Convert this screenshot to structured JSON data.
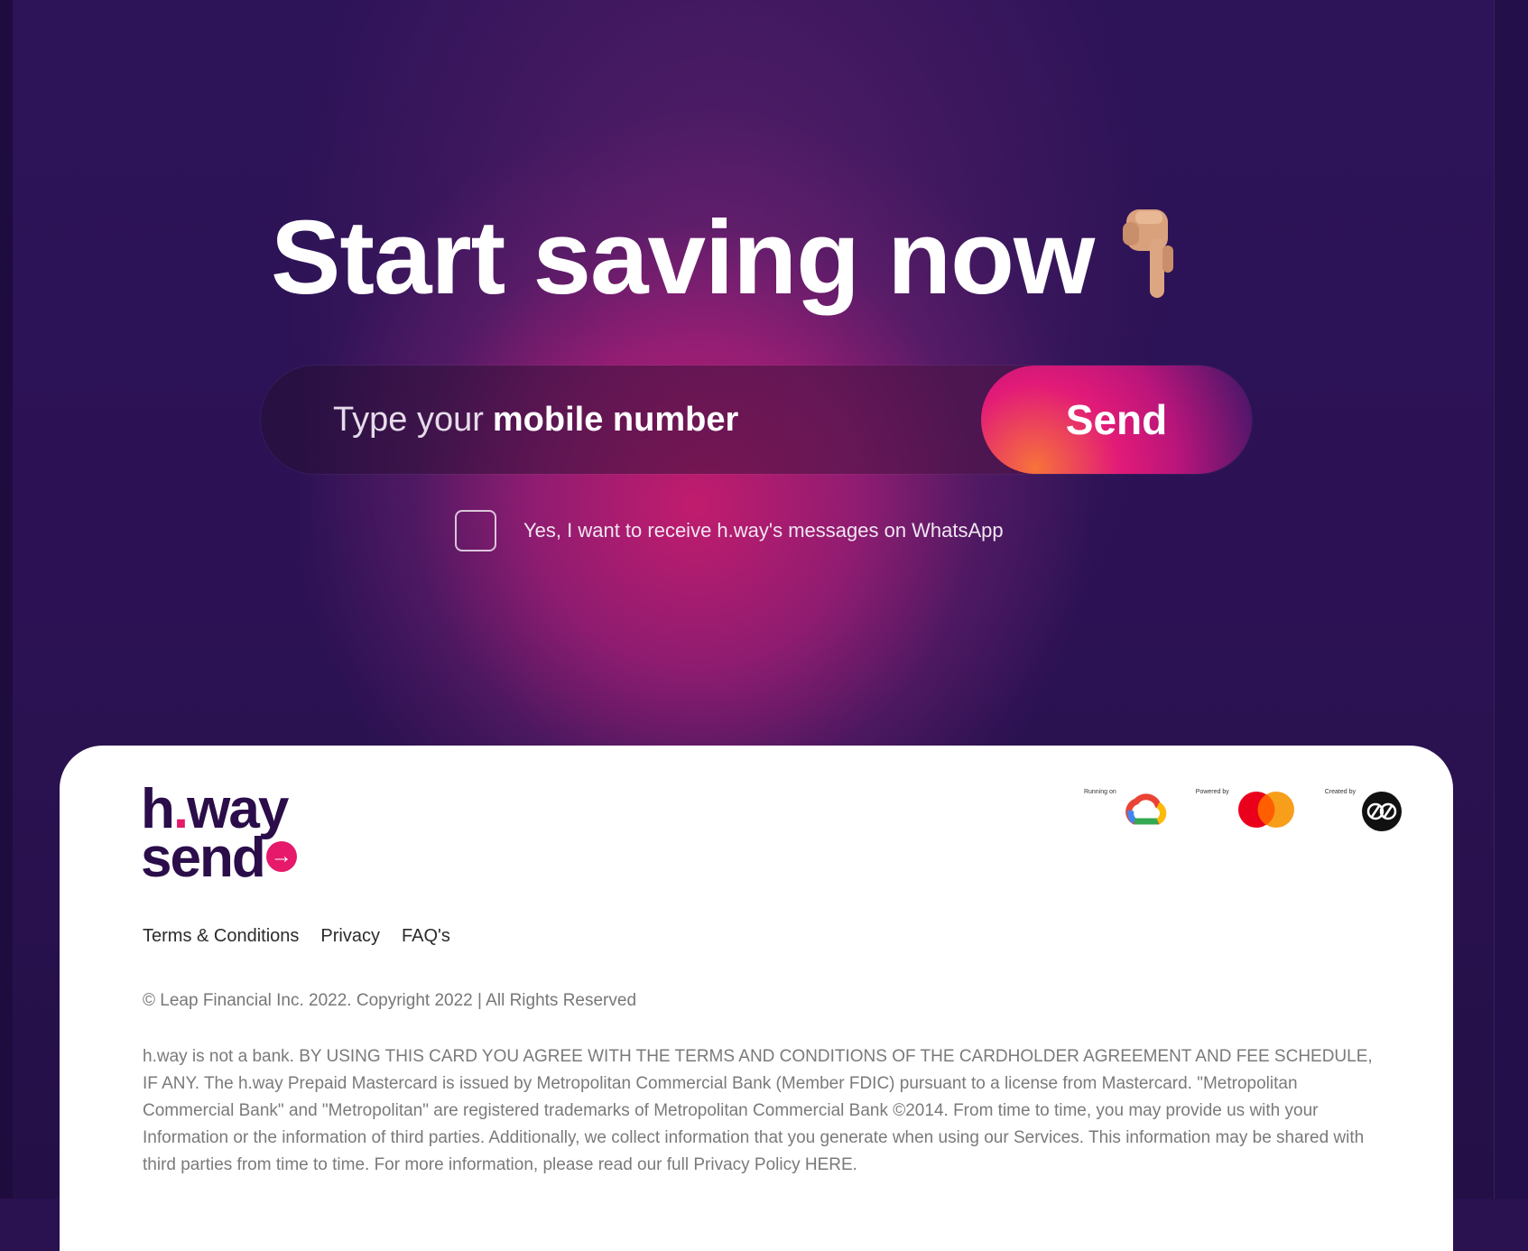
{
  "hero": {
    "headline": "Start saving now",
    "hand_emoji": "pointing-down-hand",
    "input_placeholder_light": "Type your",
    "input_placeholder_bold": "mobile number",
    "send_label": "Send",
    "consent_label": "Yes, I want to receive h.way's messages on WhatsApp",
    "consent_checked": false
  },
  "footer": {
    "logo_line1_pre": "h",
    "logo_line1_dot": ".",
    "logo_line1_post": "way",
    "logo_line2": "send",
    "partners": [
      {
        "caption": "Running on",
        "logo": "google-cloud-icon"
      },
      {
        "caption": "Powered by",
        "logo": "mastercard-icon"
      },
      {
        "caption": "Created by",
        "logo": "creator-badge-icon"
      }
    ],
    "links": [
      "Terms & Conditions",
      "Privacy",
      "FAQ's"
    ],
    "copyright": "© Leap Financial Inc. 2022. Copyright 2022 | All Rights Reserved",
    "disclaimer": "h.way is not a bank. BY USING THIS CARD YOU AGREE WITH THE TERMS AND CONDITIONS OF THE CARDHOLDER AGREEMENT AND FEE SCHEDULE, IF ANY. The h.way Prepaid Mastercard is issued by Metropolitan Commercial Bank (Member FDIC) pursuant to a license from Mastercard. \"Metropolitan Commercial Bank\" and \"Metropolitan\" are registered trademarks of Metropolitan Commercial Bank ©2014. From time to time, you may provide us with your Information or the information of third parties. Additionally, we collect information that you generate when using our Services. This information may be shared with third parties from time to time. For more information, please read our full Privacy Policy HERE."
  },
  "colors": {
    "accent": "#e6196b",
    "brand_dark": "#2b0d4a",
    "background": "#2c1254"
  }
}
